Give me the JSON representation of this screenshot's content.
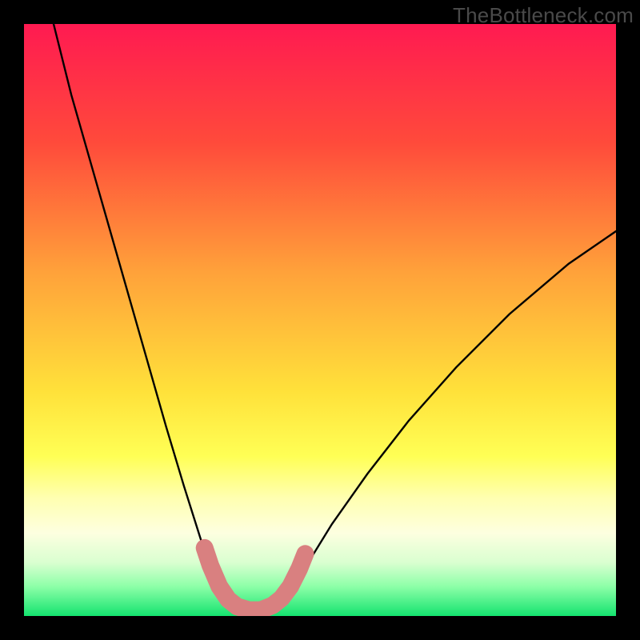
{
  "watermark": "TheBottleneck.com",
  "chart_data": {
    "type": "line",
    "title": "",
    "xlabel": "",
    "ylabel": "",
    "xlim": [
      0,
      100
    ],
    "ylim": [
      0,
      100
    ],
    "background_gradient_stops": [
      {
        "offset": 0.0,
        "color": "#ff1a51"
      },
      {
        "offset": 0.2,
        "color": "#ff4a3b"
      },
      {
        "offset": 0.42,
        "color": "#ffa23a"
      },
      {
        "offset": 0.62,
        "color": "#ffe13a"
      },
      {
        "offset": 0.73,
        "color": "#ffff55"
      },
      {
        "offset": 0.8,
        "color": "#ffffb0"
      },
      {
        "offset": 0.86,
        "color": "#fdffe0"
      },
      {
        "offset": 0.91,
        "color": "#d9ffd0"
      },
      {
        "offset": 0.95,
        "color": "#8dffa8"
      },
      {
        "offset": 1.0,
        "color": "#14e36f"
      }
    ],
    "series": [
      {
        "name": "bottleneck-curve",
        "color": "#000000",
        "points": [
          {
            "x": 5.0,
            "y": 100.0
          },
          {
            "x": 8.0,
            "y": 88.0
          },
          {
            "x": 12.0,
            "y": 74.0
          },
          {
            "x": 16.0,
            "y": 60.0
          },
          {
            "x": 20.0,
            "y": 46.0
          },
          {
            "x": 24.0,
            "y": 32.0
          },
          {
            "x": 27.0,
            "y": 22.0
          },
          {
            "x": 30.0,
            "y": 12.5
          },
          {
            "x": 32.0,
            "y": 7.0
          },
          {
            "x": 33.5,
            "y": 4.0
          },
          {
            "x": 35.0,
            "y": 2.0
          },
          {
            "x": 37.0,
            "y": 1.0
          },
          {
            "x": 39.0,
            "y": 0.7
          },
          {
            "x": 41.0,
            "y": 1.0
          },
          {
            "x": 43.0,
            "y": 2.2
          },
          {
            "x": 45.0,
            "y": 4.5
          },
          {
            "x": 48.0,
            "y": 9.0
          },
          {
            "x": 52.0,
            "y": 15.5
          },
          {
            "x": 58.0,
            "y": 24.0
          },
          {
            "x": 65.0,
            "y": 33.0
          },
          {
            "x": 73.0,
            "y": 42.0
          },
          {
            "x": 82.0,
            "y": 51.0
          },
          {
            "x": 92.0,
            "y": 59.5
          },
          {
            "x": 100.0,
            "y": 65.0
          }
        ]
      },
      {
        "name": "bottleneck-highlight",
        "color": "#d98080",
        "points": [
          {
            "x": 30.5,
            "y": 11.5
          },
          {
            "x": 31.5,
            "y": 8.5
          },
          {
            "x": 33.0,
            "y": 5.0
          },
          {
            "x": 34.5,
            "y": 2.8
          },
          {
            "x": 36.0,
            "y": 1.6
          },
          {
            "x": 38.0,
            "y": 1.0
          },
          {
            "x": 40.0,
            "y": 1.0
          },
          {
            "x": 42.0,
            "y": 1.8
          },
          {
            "x": 43.5,
            "y": 3.0
          },
          {
            "x": 45.0,
            "y": 5.0
          },
          {
            "x": 46.5,
            "y": 8.0
          },
          {
            "x": 47.5,
            "y": 10.5
          }
        ]
      }
    ]
  }
}
